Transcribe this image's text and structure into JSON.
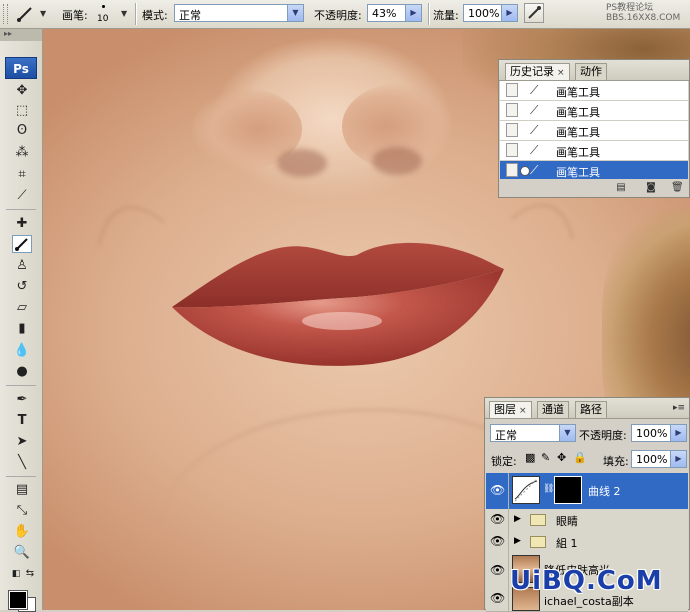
{
  "options_bar": {
    "brush_label": "画笔:",
    "brush_size": "10",
    "mode_label": "模式:",
    "mode_value": "正常",
    "opacity_label": "不透明度:",
    "opacity_value": "43%",
    "flow_label": "流量:",
    "flow_value": "100%",
    "watermark_line1": "PS教程论坛",
    "watermark_line2": "BBS.16XX8.COM"
  },
  "toolbox": {
    "logo": "Ps",
    "tools": [
      "move",
      "marquee",
      "lasso",
      "magic-wand",
      "crop",
      "slice",
      "healing-brush",
      "brush",
      "clone-stamp",
      "history-brush",
      "eraser",
      "gradient",
      "blur",
      "dodge",
      "pen",
      "type",
      "path-selection",
      "line",
      "notes",
      "eyedropper",
      "hand",
      "zoom"
    ],
    "active_tool": "brush"
  },
  "history_panel": {
    "tabs": [
      "历史记录",
      "动作"
    ],
    "rows": [
      "画笔工具",
      "画笔工具",
      "画笔工具",
      "画笔工具",
      "画笔工具"
    ],
    "selected_index": 4
  },
  "layers_panel": {
    "tabs": [
      "图层",
      "通道",
      "路径"
    ],
    "blend_mode": "正常",
    "opacity_label": "不透明度:",
    "opacity_value": "100%",
    "lock_label": "锁定:",
    "fill_label": "填充:",
    "fill_value": "100%",
    "layers": [
      {
        "name": "曲线 2",
        "type": "adjustment",
        "selected": true
      },
      {
        "name": "眼睛",
        "type": "group"
      },
      {
        "name": "組 1",
        "type": "group"
      },
      {
        "name": "降低皮肤高光",
        "type": "pixel"
      },
      {
        "name": "ichael_costa副本",
        "type": "pixel"
      }
    ]
  },
  "bottom_watermark": "UiBQ.CoM",
  "colors": {
    "selection": "#316ac5",
    "panel_bg": "#d4d0c8",
    "ps_blue": "#1d4ea3"
  }
}
